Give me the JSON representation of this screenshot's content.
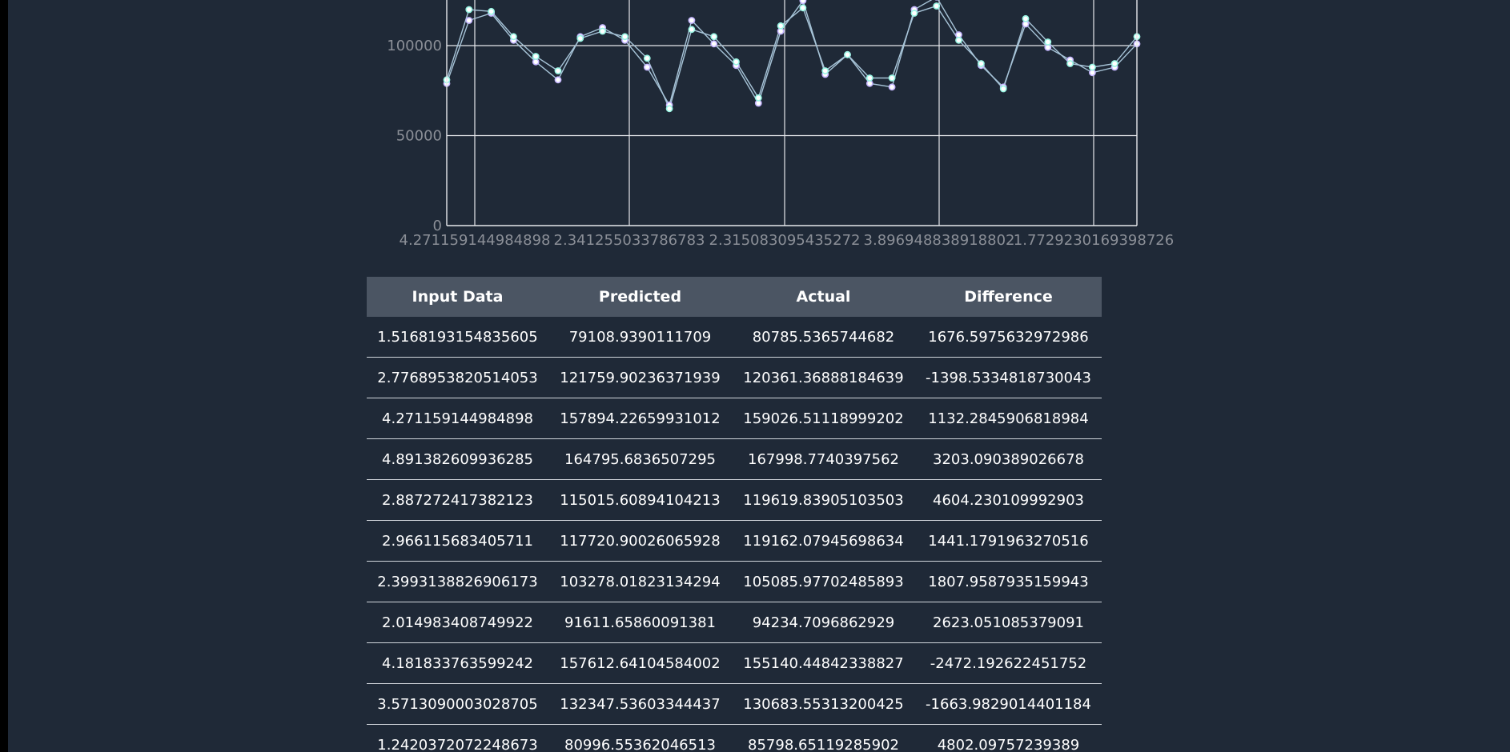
{
  "chart_data": {
    "type": "line",
    "xlabel": "",
    "ylabel": "",
    "ylim": [
      0,
      150000
    ],
    "y_ticks": [
      "0",
      "50000",
      "100000"
    ],
    "x_tick_labels": [
      "4.271159144984898",
      "2.341255033786783",
      "2.315083095435272",
      "3.896948838918802",
      "1.7729230169398726"
    ],
    "grid": true,
    "colors": {
      "predicted": "#c4b5fd",
      "actual": "#99f6e4",
      "line": "#a7c4d8",
      "grid": "#e5e7eb",
      "tick_text": "#8b8f97"
    },
    "series": [
      {
        "key": "predicted",
        "values": [
          79000,
          114000,
          118000,
          103000,
          91000,
          81000,
          105000,
          110000,
          103000,
          88000,
          67000,
          114000,
          101000,
          89000,
          68000,
          108000,
          125000,
          84000,
          95000,
          79000,
          77000,
          120000,
          127000,
          106000,
          89000,
          77000,
          112000,
          99000,
          92000,
          85000,
          88000,
          101000
        ]
      },
      {
        "key": "actual",
        "values": [
          81000,
          120000,
          119000,
          105000,
          94000,
          86000,
          104000,
          108000,
          105000,
          93000,
          65000,
          109000,
          105000,
          91000,
          71000,
          111000,
          121000,
          86000,
          95000,
          82000,
          82000,
          118000,
          122000,
          103000,
          90000,
          76000,
          115000,
          102000,
          90000,
          88000,
          90000,
          105000
        ]
      }
    ]
  },
  "table": {
    "headers": {
      "input": "Input Data",
      "predicted": "Predicted",
      "actual": "Actual",
      "difference": "Difference"
    },
    "rows": [
      [
        "1.5168193154835605",
        "79108.9390111709",
        "80785.5365744682",
        "1676.5975632972986"
      ],
      [
        "2.7768953820514053",
        "121759.90236371939",
        "120361.36888184639",
        "-1398.5334818730043"
      ],
      [
        "4.271159144984898",
        "157894.22659931012",
        "159026.51118999202",
        "1132.2845906818984"
      ],
      [
        "4.891382609936285",
        "164795.6836507295",
        "167998.7740397562",
        "3203.090389026678"
      ],
      [
        "2.887272417382123",
        "115015.60894104213",
        "119619.83905103503",
        "4604.230109992903"
      ],
      [
        "2.966115683405711",
        "117720.90026065928",
        "119162.07945698634",
        "1441.1791963270516"
      ],
      [
        "2.3993138826906173",
        "103278.01823134294",
        "105085.97702485893",
        "1807.9587935159943"
      ],
      [
        "2.014983408749922",
        "91611.65860091381",
        "94234.7096862929",
        "2623.051085379091"
      ],
      [
        "4.181833763599242",
        "157612.64104584002",
        "155140.44842338827",
        "-2472.192622451752"
      ],
      [
        "3.5713090003028705",
        "132347.53603344437",
        "130683.55313200425",
        "-1663.9829014401184"
      ],
      [
        "1.2420372072248673",
        "80996.55362046513",
        "85798.65119285902",
        "4802.09757239389"
      ]
    ]
  }
}
